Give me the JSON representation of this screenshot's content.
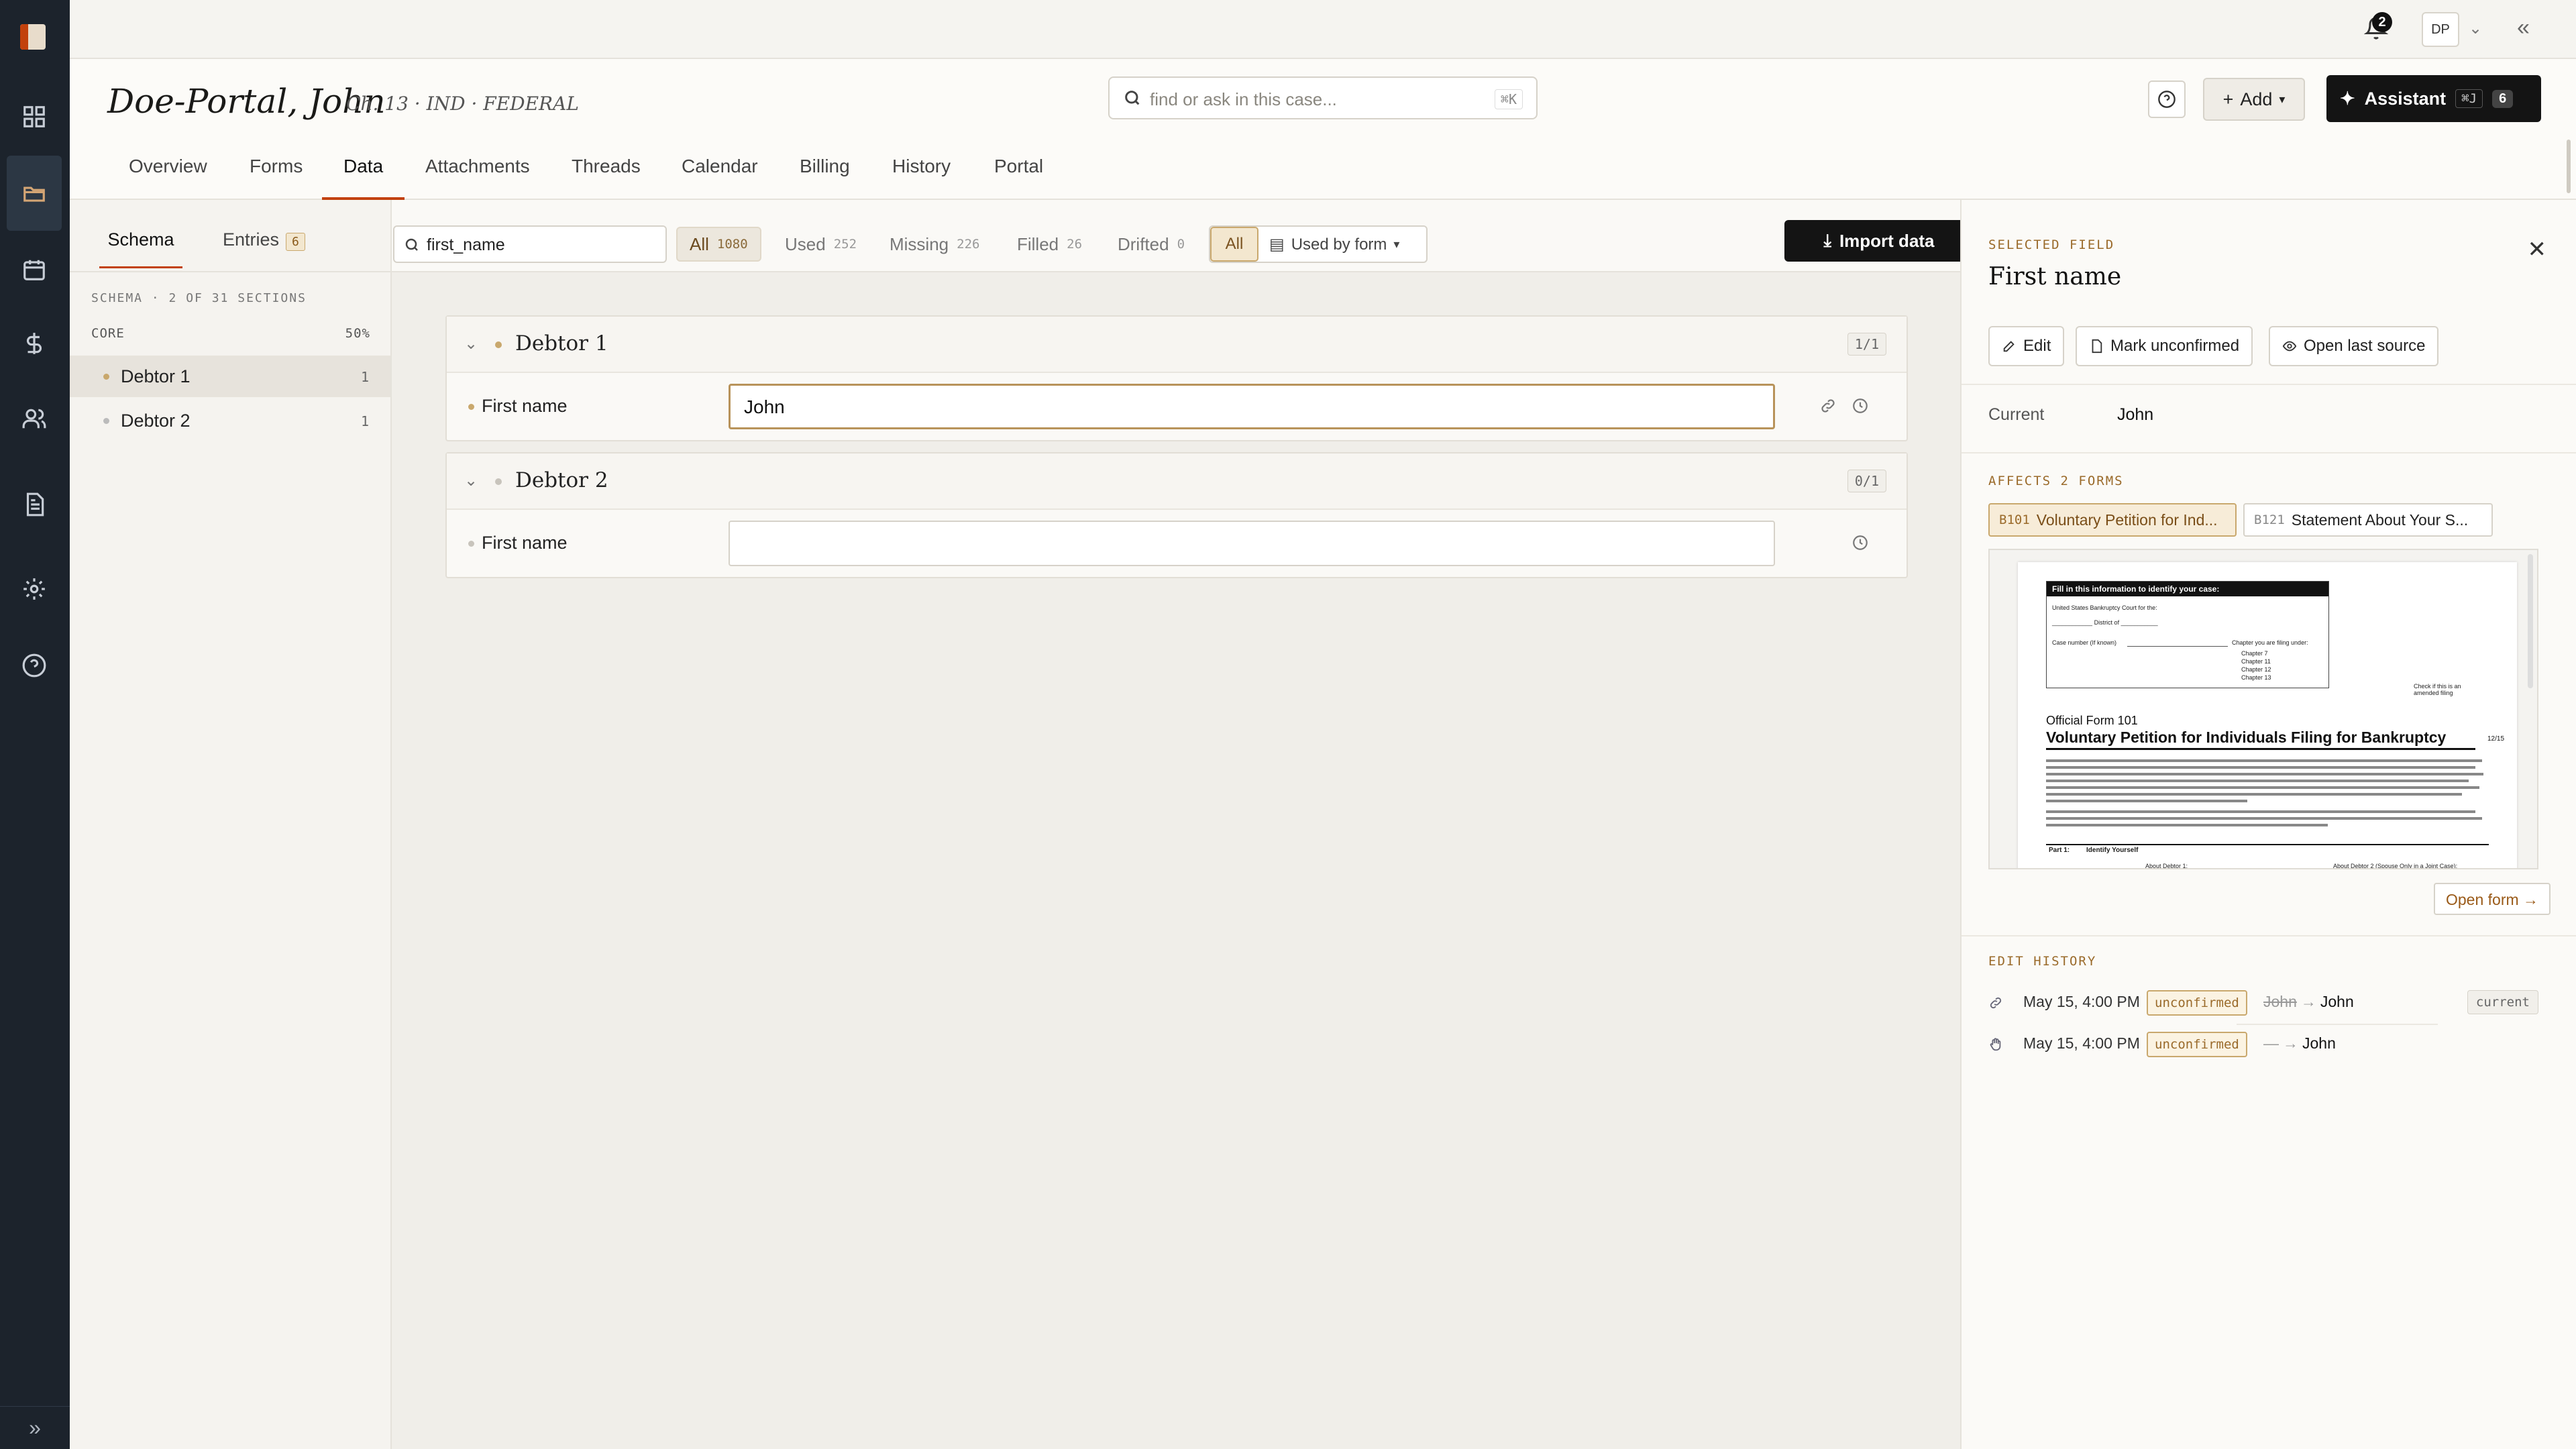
{
  "topbar": {
    "notifications_count": "2",
    "user_initials": "DP"
  },
  "case": {
    "title": "Doe-Portal, John",
    "subtitle": "Ch. 13 · IND · FEDERAL",
    "search_placeholder": "find or ask in this case...",
    "search_shortcut": "⌘K",
    "add_label": "Add",
    "assistant_label": "Assistant",
    "assistant_shortcut": "⌘J",
    "assistant_count": "6"
  },
  "tabs": [
    "Overview",
    "Forms",
    "Data",
    "Attachments",
    "Threads",
    "Calendar",
    "Billing",
    "History",
    "Portal"
  ],
  "active_tab": "Data",
  "schema_panel": {
    "tab_schema": "Schema",
    "tab_entries": "Entries",
    "entries_count": "6",
    "caption": "SCHEMA · 2 OF 31 SECTIONS",
    "group_label": "CORE",
    "group_pct": "50%",
    "sections": [
      {
        "label": "Debtor 1",
        "count": "1"
      },
      {
        "label": "Debtor 2",
        "count": "1"
      }
    ]
  },
  "filters": {
    "search_value": "first_name",
    "chips": [
      {
        "label": "All",
        "count": "1080"
      },
      {
        "label": "Used",
        "count": "252"
      },
      {
        "label": "Missing",
        "count": "226"
      },
      {
        "label": "Filled",
        "count": "26"
      },
      {
        "label": "Drifted",
        "count": "0"
      }
    ],
    "scope_all": "All",
    "scope_by_form": "Used by form",
    "import_label": "Import data"
  },
  "cards": [
    {
      "name": "Debtor 1",
      "fraction": "1/1",
      "field_label": "First name",
      "field_value": "John"
    },
    {
      "name": "Debtor 2",
      "fraction": "0/1",
      "field_label": "First name",
      "field_value": ""
    }
  ],
  "detail": {
    "caption": "SELECTED FIELD",
    "title": "First name",
    "edit_label": "Edit",
    "mark_label": "Mark unconfirmed",
    "open_source_label": "Open last source",
    "current_label": "Current",
    "current_value": "John",
    "affects_caption": "AFFECTS 2 FORMS",
    "forms": [
      {
        "code": "B101",
        "name": "Voluntary Petition for Ind..."
      },
      {
        "code": "B121",
        "name": "Statement About Your S..."
      }
    ],
    "open_form_label": "Open form →",
    "history_caption": "EDIT HISTORY",
    "history": [
      {
        "time": "May 15, 4:00 PM",
        "status": "unconfirmed",
        "old": "John",
        "arrow": "→",
        "new": "John",
        "tag": "current"
      },
      {
        "time": "May 15, 4:00 PM",
        "status": "unconfirmed",
        "old": "—",
        "arrow": "→",
        "new": "John",
        "tag": ""
      }
    ]
  },
  "preview": {
    "box_header": "Fill in this information to identify your case:",
    "court_line": "United States Bankruptcy Court for the:",
    "district_line": "____________ District of ___________",
    "case_number": "Case number (If known)",
    "chapter_caption": "Chapter you are filing under:",
    "chapters": [
      "Chapter 7",
      "Chapter 11",
      "Chapter 12",
      "Chapter 13"
    ],
    "amended": "Check if this is an amended filing",
    "form_number": "Official Form 101",
    "form_title": "Voluntary Petition for Individuals Filing for Bankruptcy",
    "form_date": "12/15",
    "part_label": "Part 1:",
    "part_title": "Identify Yourself",
    "col1": "About Debtor 1:",
    "col2": "About Debtor 2 (Spouse Only in a Joint Case):"
  }
}
